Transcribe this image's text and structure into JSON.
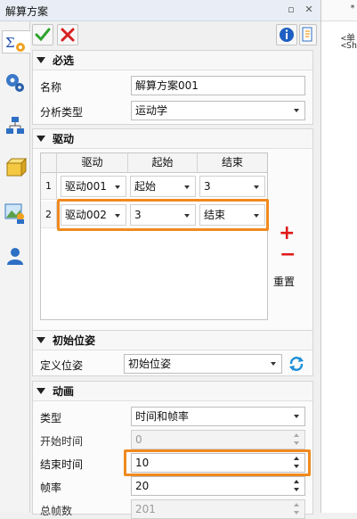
{
  "window": {
    "title": "解算方案"
  },
  "right_panel": {
    "tab_marker": "*",
    "lines": [
      "<单",
      "<Sh"
    ]
  },
  "sections": {
    "required": {
      "title": "必选",
      "name_label": "名称",
      "name_value": "解算方案001",
      "analysis_label": "分析类型",
      "analysis_value": "运动学"
    },
    "drive": {
      "title": "驱动",
      "columns": [
        "驱动",
        "起始",
        "结束"
      ],
      "rows": [
        {
          "index": "1",
          "drive": "驱动001",
          "start": "起始",
          "end": "3"
        },
        {
          "index": "2",
          "drive": "驱动002",
          "start": "3",
          "end": "结束"
        }
      ],
      "add_symbol": "+",
      "remove_symbol": "−",
      "reset_label": "重置"
    },
    "initial": {
      "title": "初始位姿",
      "define_label": "定义位姿",
      "define_value": "初始位姿"
    },
    "animation": {
      "title": "动画",
      "type_label": "类型",
      "type_value": "时间和帧率",
      "start_label": "开始时间",
      "start_value": "0",
      "end_label": "结束时间",
      "end_value": "10",
      "rate_label": "帧率",
      "rate_value": "20",
      "total_label": "总帧数",
      "total_value": "201"
    }
  },
  "colors": {
    "highlight": "#f08a1e",
    "confirm": "#2ea32e",
    "cancel": "#d82020",
    "info": "#1d5fc2"
  }
}
